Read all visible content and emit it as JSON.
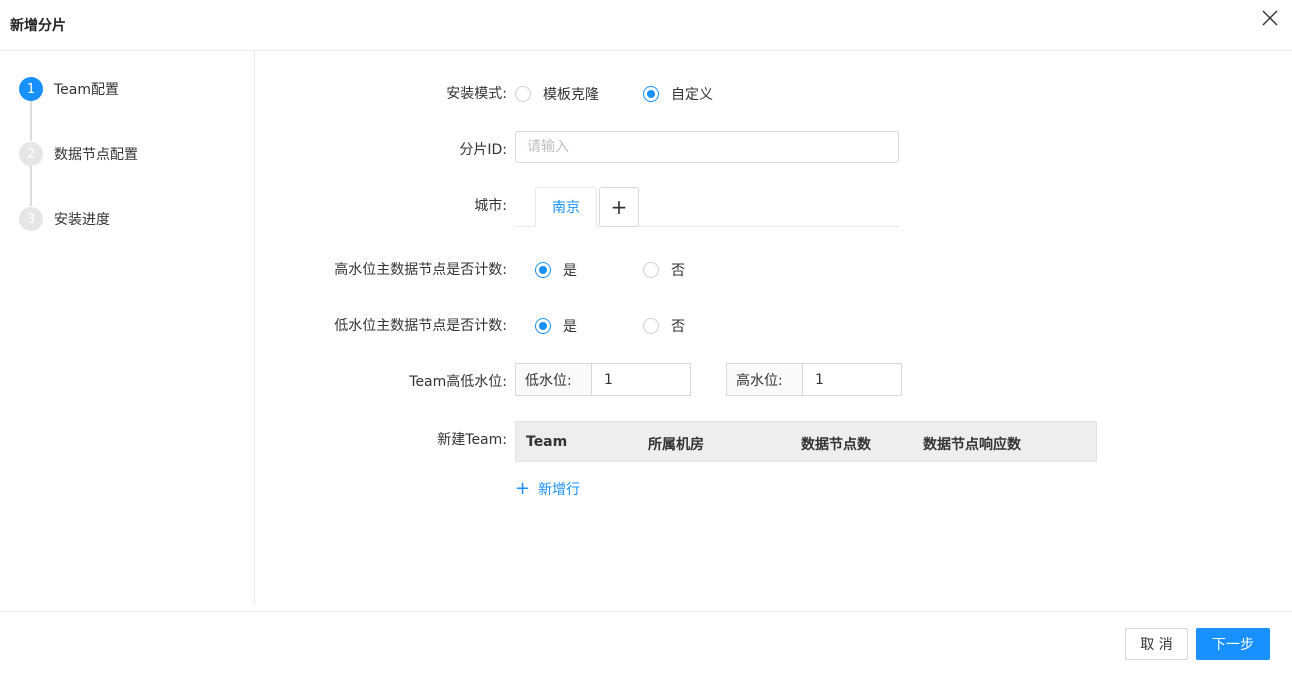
{
  "dialog": {
    "title": "新增分片",
    "close_icon": "close-icon"
  },
  "steps": [
    {
      "num": "1",
      "label": "Team配置",
      "active": true
    },
    {
      "num": "2",
      "label": "数据节点配置",
      "active": false
    },
    {
      "num": "3",
      "label": "安装进度",
      "active": false
    }
  ],
  "form": {
    "install_mode": {
      "label": "安装模式:",
      "options": [
        "模板克隆",
        "自定义"
      ],
      "selected": "自定义"
    },
    "shard_id": {
      "label": "分片ID:",
      "placeholder": "请输入",
      "value": ""
    },
    "city": {
      "label": "城市:",
      "tabs": [
        "南京"
      ],
      "add_label": "+"
    },
    "high_water_count": {
      "label": "高水位主数据节点是否计数:",
      "options": [
        "是",
        "否"
      ],
      "selected": "是"
    },
    "low_water_count": {
      "label": "低水位主数据节点是否计数:",
      "options": [
        "是",
        "否"
      ],
      "selected": "是"
    },
    "team_water": {
      "label": "Team高低水位:",
      "low_label": "低水位:",
      "low_value": "1",
      "high_label": "高水位:",
      "high_value": "1"
    },
    "new_team": {
      "label": "新建Team:",
      "columns": [
        "Team",
        "所属机房",
        "数据节点数",
        "数据节点响应数"
      ],
      "add_row_label": "新增行"
    }
  },
  "footer": {
    "cancel_label": "取 消",
    "next_label": "下一步"
  },
  "colors": {
    "accent": "#1890ff",
    "border": "#d9d9d9",
    "table_head_bg": "#eeeeee"
  }
}
